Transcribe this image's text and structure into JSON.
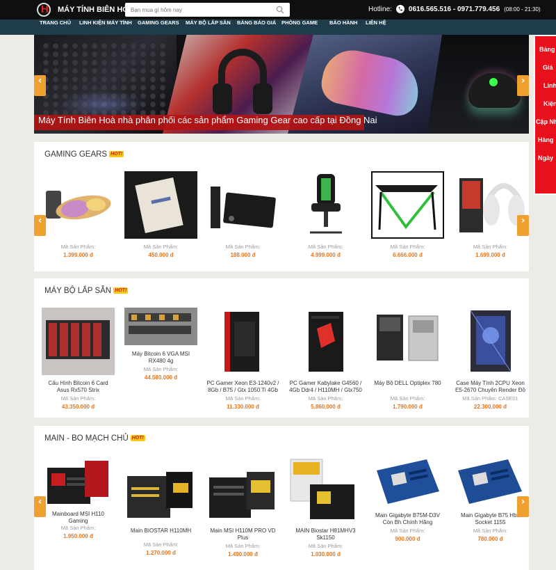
{
  "header": {
    "logo_text": "MÁY TÍNH BIÊN HÒA",
    "search_placeholder": "Bạn mua gì hôm nay",
    "hotline_label": "Hotline:",
    "hotline_numbers": "0616.565.516 - 0971.779.456",
    "hours": "(08:00 - 21:30)"
  },
  "nav": [
    "TRANG CHỦ",
    "LINH KIỆN MÁY TÍNH",
    "GAMING GEARS",
    "MÁY BỘ LẮP SẴN",
    "BẢNG BÁO GIÁ",
    "PHÒNG GAME",
    "BẢO HÀNH",
    "LIÊN HỆ"
  ],
  "banner": {
    "caption": "Máy Tính Biên Hoà nhà phân phối các sản phẩm Gaming Gear cao cấp tại Đồng Nai"
  },
  "side_banner": [
    "Bảng",
    "Giá",
    "Linh",
    "Kiện",
    "Cập Nhật",
    "Hàng",
    "Ngày"
  ],
  "hot_badge": "HoT!",
  "code_label": "Mã Sản Phẩm:",
  "sections": [
    {
      "title": "GAMING GEARS",
      "items": [
        {
          "name": "",
          "price": "1.399.000 đ"
        },
        {
          "name": "",
          "price": "450.000 đ"
        },
        {
          "name": "",
          "price": "188.000 đ"
        },
        {
          "name": "",
          "price": "4.999.000 đ"
        },
        {
          "name": "",
          "price": "6.666.000 đ"
        },
        {
          "name": "",
          "price": "1.699.000 đ"
        }
      ]
    },
    {
      "title": "MÁY BỘ LẮP SẴN",
      "items": [
        {
          "name": "Cấu Hình Bitcoin 6 Card Asus Rx570 Strix",
          "price": "43.350.000 đ"
        },
        {
          "name": "Máy Bitcoin 6 VGA MSI RX480 4g",
          "price": "44.580.000 đ"
        },
        {
          "name": "PC Gamer Xeon E3-1240v2 / 8Gb / B75 / Gtx 1050 Ti 4Gb",
          "price": "11.330.000 đ"
        },
        {
          "name": "PC Gamer Kabylake G4560 / 4Gb Ddr4 / H110MH / Gtx750",
          "price": "5.860.000 đ"
        },
        {
          "name": "Máy Bộ DELL Optiplex 780",
          "price": "1.790.000 đ"
        },
        {
          "name": "Case Máy Tính 2CPU Xeon E5-2670 Chuyên Render Đồ Họa",
          "code": "CASE01",
          "price": "22.300.000 đ"
        }
      ]
    },
    {
      "title": "MAIN - BO MẠCH CHỦ",
      "items": [
        {
          "name": "Mainboard MSI H110 Gaming",
          "price": "1.950.000 đ"
        },
        {
          "name": "Main BIOSTAR H110MH",
          "price": "1.270.000 đ"
        },
        {
          "name": "Main MSI H110M PRO VD Plus",
          "price": "1.490.000 đ"
        },
        {
          "name": "MAIN Biostar H81MHV3 Sk1150",
          "price": "1.030.000 đ"
        },
        {
          "name": "Main Gigabyte B75M-D3V Còn Bh Chính Hãng",
          "price": "900.000 đ"
        },
        {
          "name": "Main Gigabyte B75 Hbh Socket 1155",
          "price": "780.000 đ"
        }
      ]
    }
  ],
  "colors": {
    "nav_bg": "#1e3c4b",
    "accent": "#f0a030",
    "price": "#e9741c",
    "side_banner": "#e8101b",
    "caption_bg": "#b41414"
  }
}
